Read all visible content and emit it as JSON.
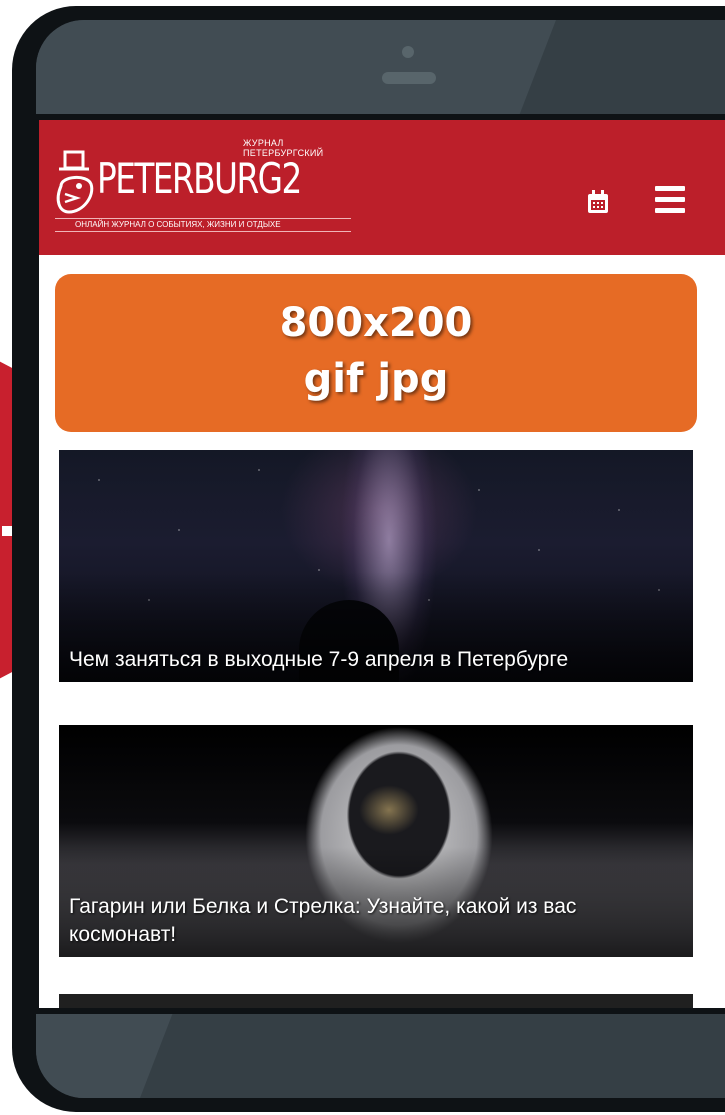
{
  "header": {
    "logo_text": "PETERBURG2",
    "logo_tagline_top": "Журнал Петербургский",
    "logo_subline": "онлайн журнал о событиях, жизни и отдыхе",
    "calendar_icon": "calendar-icon",
    "menu_icon": "hamburger-menu-icon",
    "brand_color": "#bc1f2a"
  },
  "ad_banner": {
    "line1": "800x200",
    "line2": "gif jpg",
    "color": "#e66b25"
  },
  "articles": [
    {
      "title": "Чем заняться в выходные 7-9 апреля в Петербурге"
    },
    {
      "title": "Гагарин или Белка и Стрелка: Узнайте, какой из вас космонавт!"
    }
  ]
}
